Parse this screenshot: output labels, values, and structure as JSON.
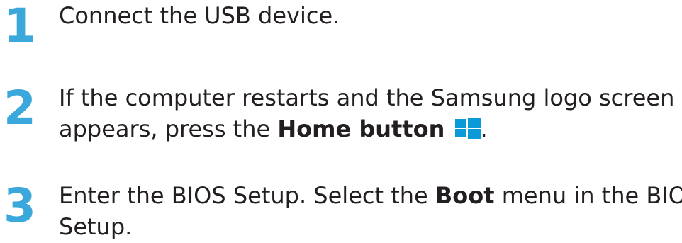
{
  "steps": [
    {
      "number": "1",
      "line1": "Connect the USB device."
    },
    {
      "number": "2",
      "line1": "If the computer restarts and the Samsung logo screen",
      "line2_pre": "appears, press the ",
      "line2_bold": "Home button",
      "line2_post": ".",
      "icon": "windows-home-icon",
      "icon_color": "#0a9ad8"
    },
    {
      "number": "3",
      "line1_pre": "Enter the BIOS Setup. Select the ",
      "line1_bold": "Boot",
      "line1_post": " menu in the BIOS",
      "line2": "Setup."
    }
  ],
  "colors": {
    "step_number": "#3aa8db",
    "text": "#231f20"
  }
}
